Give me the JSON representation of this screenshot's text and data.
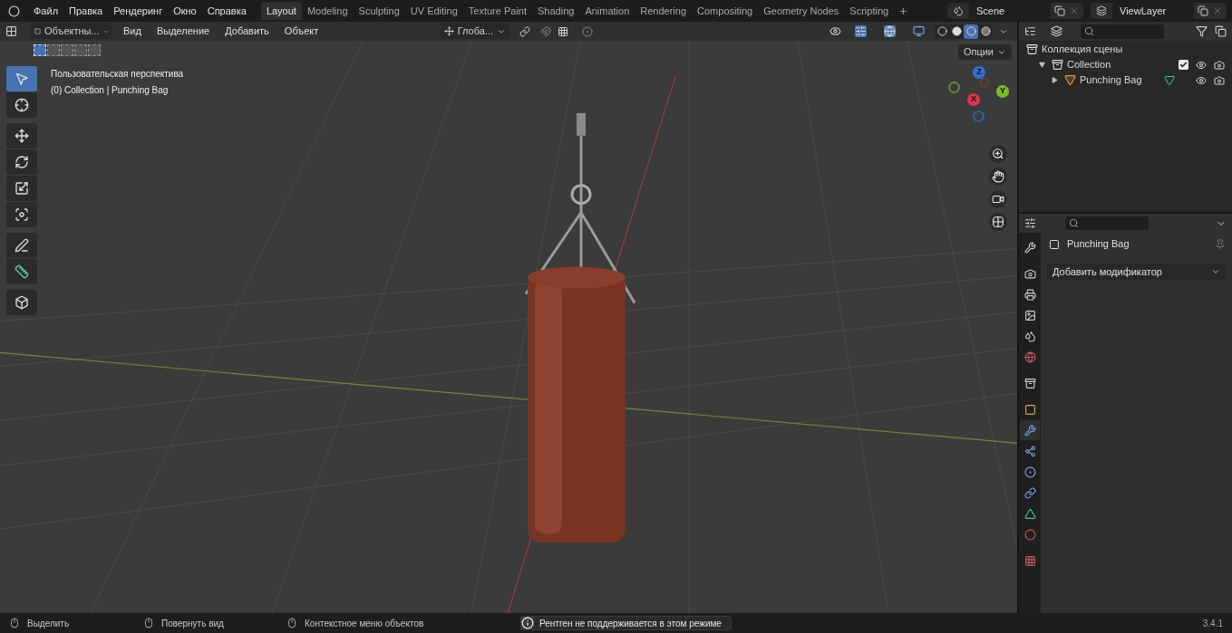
{
  "top_menu": [
    "Файл",
    "Правка",
    "Рендеринг",
    "Окно",
    "Справка"
  ],
  "workspaces": [
    {
      "label": "Layout",
      "selected": true
    },
    {
      "label": "Modeling",
      "selected": false
    },
    {
      "label": "Sculpting",
      "selected": false
    },
    {
      "label": "UV Editing",
      "selected": false
    },
    {
      "label": "Texture Paint",
      "selected": false
    },
    {
      "label": "Shading",
      "selected": false
    },
    {
      "label": "Animation",
      "selected": false
    },
    {
      "label": "Rendering",
      "selected": false
    },
    {
      "label": "Compositing",
      "selected": false
    },
    {
      "label": "Geometry Nodes",
      "selected": false
    },
    {
      "label": "Scripting",
      "selected": false
    }
  ],
  "add_workspace": "+",
  "scene": {
    "value": "Scene"
  },
  "view_layer": {
    "value": "ViewLayer"
  },
  "viewport": {
    "mode": "Объектны...",
    "menus": [
      "Вид",
      "Выделение",
      "Добавить",
      "Объект"
    ],
    "transform": "Глоба...",
    "shading": [
      {
        "selected": false
      },
      {
        "selected": false
      },
      {
        "selected": true
      },
      {
        "selected": false
      }
    ],
    "select_modes": [
      {
        "selected": true
      },
      {
        "selected": false
      },
      {
        "selected": false
      },
      {
        "selected": false
      },
      {
        "selected": false
      }
    ],
    "tools": [
      {
        "selected": true
      },
      {
        "selected": false
      },
      {
        "selected": false
      },
      {
        "selected": false
      },
      {
        "selected": false
      },
      {
        "selected": false
      },
      {
        "selected": false
      },
      {
        "selected": false
      },
      {
        "selected": false
      }
    ],
    "overlay_text": [
      "Пользовательская перспектива",
      "(0) Collection | Punching Bag"
    ],
    "options": "Опции",
    "gizmo": {
      "x": "X",
      "y": "Y",
      "z": "Z"
    }
  },
  "outliner": {
    "items": [
      {
        "label": "Коллекция сцены",
        "children": [
          {
            "label": "Collection",
            "expanded": true,
            "checked": true,
            "children": [
              {
                "label": "Punching Bag",
                "expanded": false
              }
            ]
          }
        ]
      }
    ]
  },
  "properties": {
    "tabs": [
      {
        "selected": false
      },
      {
        "selected": false
      },
      {
        "selected": false
      },
      {
        "selected": false
      },
      {
        "selected": false
      },
      {
        "selected": false
      },
      {
        "selected": false
      },
      {
        "selected": false
      },
      {
        "selected": true
      },
      {
        "selected": false
      },
      {
        "selected": false
      },
      {
        "selected": false
      },
      {
        "selected": false
      },
      {
        "selected": false
      },
      {
        "selected": false
      }
    ],
    "object": "Punching Bag",
    "add_modifier": "Добавить модификатор"
  },
  "status_bar": {
    "hints": [
      "Выделить",
      "Повернуть вид",
      "Контекстное меню объектов"
    ],
    "message": "Рентген не поддерживается в этом режиме",
    "version": "3.4.1"
  }
}
